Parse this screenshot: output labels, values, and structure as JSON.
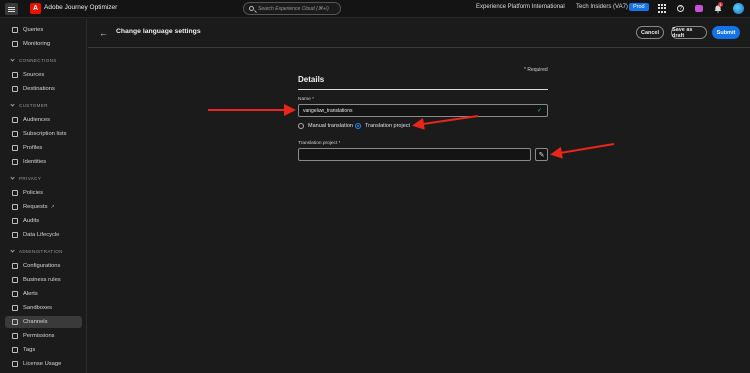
{
  "topbar": {
    "app_title": "Adobe Journey Optimizer",
    "logo_letter": "A",
    "search_placeholder": "Search Experience Cloud (⌘+/)",
    "org": "Experience Platform International",
    "tenant": "Tech Insiders (VA7)",
    "env_badge": "Prod",
    "notification_count": "1",
    "help_glyph": "?"
  },
  "sidebar": {
    "items_top": [
      {
        "label": "Queries",
        "icon": "queries-icon"
      },
      {
        "label": "Monitoring",
        "icon": "monitoring-icon"
      }
    ],
    "connections": {
      "title": "CONNECTIONS",
      "items": [
        {
          "label": "Sources",
          "icon": "sources-icon"
        },
        {
          "label": "Destinations",
          "icon": "destinations-icon"
        }
      ]
    },
    "customer": {
      "title": "CUSTOMER",
      "items": [
        {
          "label": "Audiences",
          "icon": "audiences-icon"
        },
        {
          "label": "Subscription lists",
          "icon": "subscription-icon"
        },
        {
          "label": "Profiles",
          "icon": "profiles-icon"
        },
        {
          "label": "Identities",
          "icon": "identities-icon"
        }
      ]
    },
    "privacy": {
      "title": "PRIVACY",
      "items": [
        {
          "label": "Policies",
          "icon": "policies-icon"
        },
        {
          "label": "Requests",
          "icon": "requests-icon"
        },
        {
          "label": "Audits",
          "icon": "audits-icon"
        },
        {
          "label": "Data Lifecycle",
          "icon": "data-lifecycle-icon"
        }
      ]
    },
    "administration": {
      "title": "ADMINISTRATION",
      "items": [
        {
          "label": "Configurations",
          "icon": "configurations-icon"
        },
        {
          "label": "Business rules",
          "icon": "business-rules-icon"
        },
        {
          "label": "Alerts",
          "icon": "alerts-icon"
        },
        {
          "label": "Sandboxes",
          "icon": "sandboxes-icon"
        },
        {
          "label": "Channels",
          "icon": "channels-icon",
          "active": true
        },
        {
          "label": "Permissions",
          "icon": "permissions-icon"
        },
        {
          "label": "Tags",
          "icon": "tags-icon"
        },
        {
          "label": "License Usage",
          "icon": "license-usage-icon"
        }
      ]
    }
  },
  "header": {
    "title": "Change language settings",
    "cancel_label": "Cancel",
    "draft_label": "Save as draft",
    "submit_label": "Submit"
  },
  "form": {
    "required_note": "* Required",
    "section_title": "Details",
    "name_label": "Name *",
    "name_value": "vangeluw_translations",
    "radio_manual": "Manual translation",
    "radio_project": "Translation project",
    "selected_option": "Translation project",
    "project_label": "Translation project *",
    "project_value": ""
  },
  "colors": {
    "accent": "#1473e6",
    "annotation_arrow": "#e8261b",
    "valid_check": "#3fbf6a"
  }
}
